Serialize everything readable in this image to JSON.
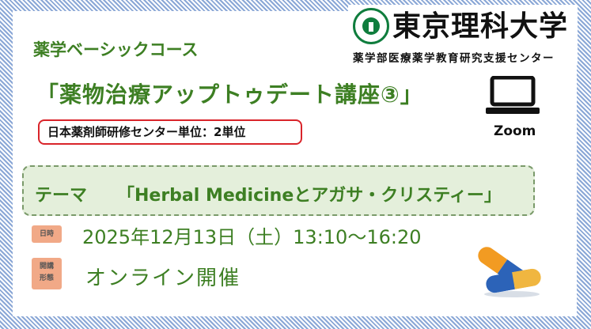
{
  "logo": {
    "university": "東京理科大学",
    "department": "薬学部医療薬学教育研究支援センター"
  },
  "course_name": "薬学ベーシックコース",
  "lecture_title": "「薬物治療アップトゥデート講座③」",
  "credit": "日本薬剤師研修センター単位：2単位",
  "delivery": {
    "icon": "laptop-icon",
    "label": "Zoom"
  },
  "theme": {
    "label": "テーマ",
    "text": "「Herbal Medicineとアガサ・クリスティー」"
  },
  "schedule": {
    "date_badge": "日時",
    "date": "2025年12月13日（土）13:10～16:20",
    "format_badge_line1": "開講",
    "format_badge_line2": "形態",
    "format": "オンライン開催"
  },
  "decoration": {
    "icon": "pill-capsules-icon"
  },
  "colors": {
    "accent_green": "#3d7f23",
    "credit_border": "#d9242a",
    "theme_box": "#e4efdb",
    "badge": "#f1a987",
    "border_stripes": "#8aa7d6",
    "logo_green": "#0f7d3d"
  }
}
